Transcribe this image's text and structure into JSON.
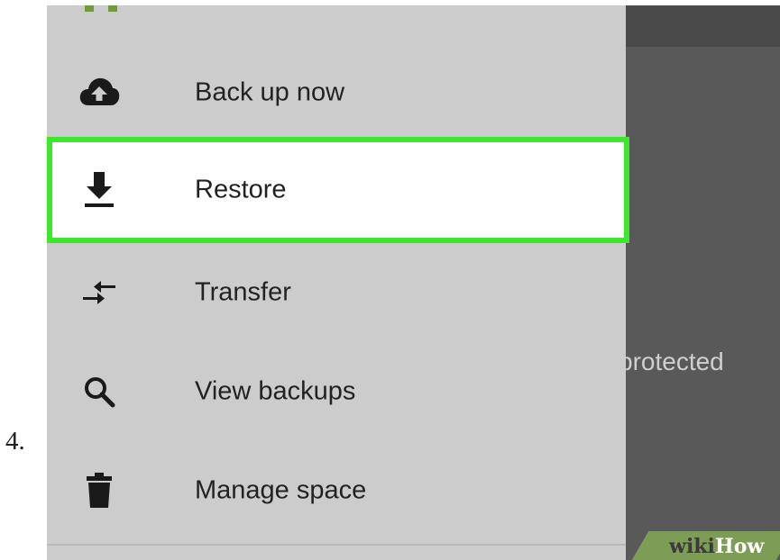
{
  "step": {
    "number": "4."
  },
  "background": {
    "partial_text": "protected"
  },
  "menu": {
    "items": [
      {
        "label": "Back up now",
        "icon": "cloud-upload-icon",
        "highlighted": false
      },
      {
        "label": "Restore",
        "icon": "download-icon",
        "highlighted": true
      },
      {
        "label": "Transfer",
        "icon": "transfer-arrows-icon",
        "highlighted": false
      },
      {
        "label": "View backups",
        "icon": "search-icon",
        "highlighted": false
      },
      {
        "label": "Manage space",
        "icon": "trash-icon",
        "highlighted": false
      }
    ]
  },
  "watermark": {
    "part1": "wiki",
    "part2": "How"
  },
  "colors": {
    "drawer_bg": "#cccccc",
    "highlight_border": "#3ee62e",
    "highlight_bg": "#ffffff",
    "overlay_bg": "#595959",
    "watermark_bg": "#7d9d57"
  }
}
